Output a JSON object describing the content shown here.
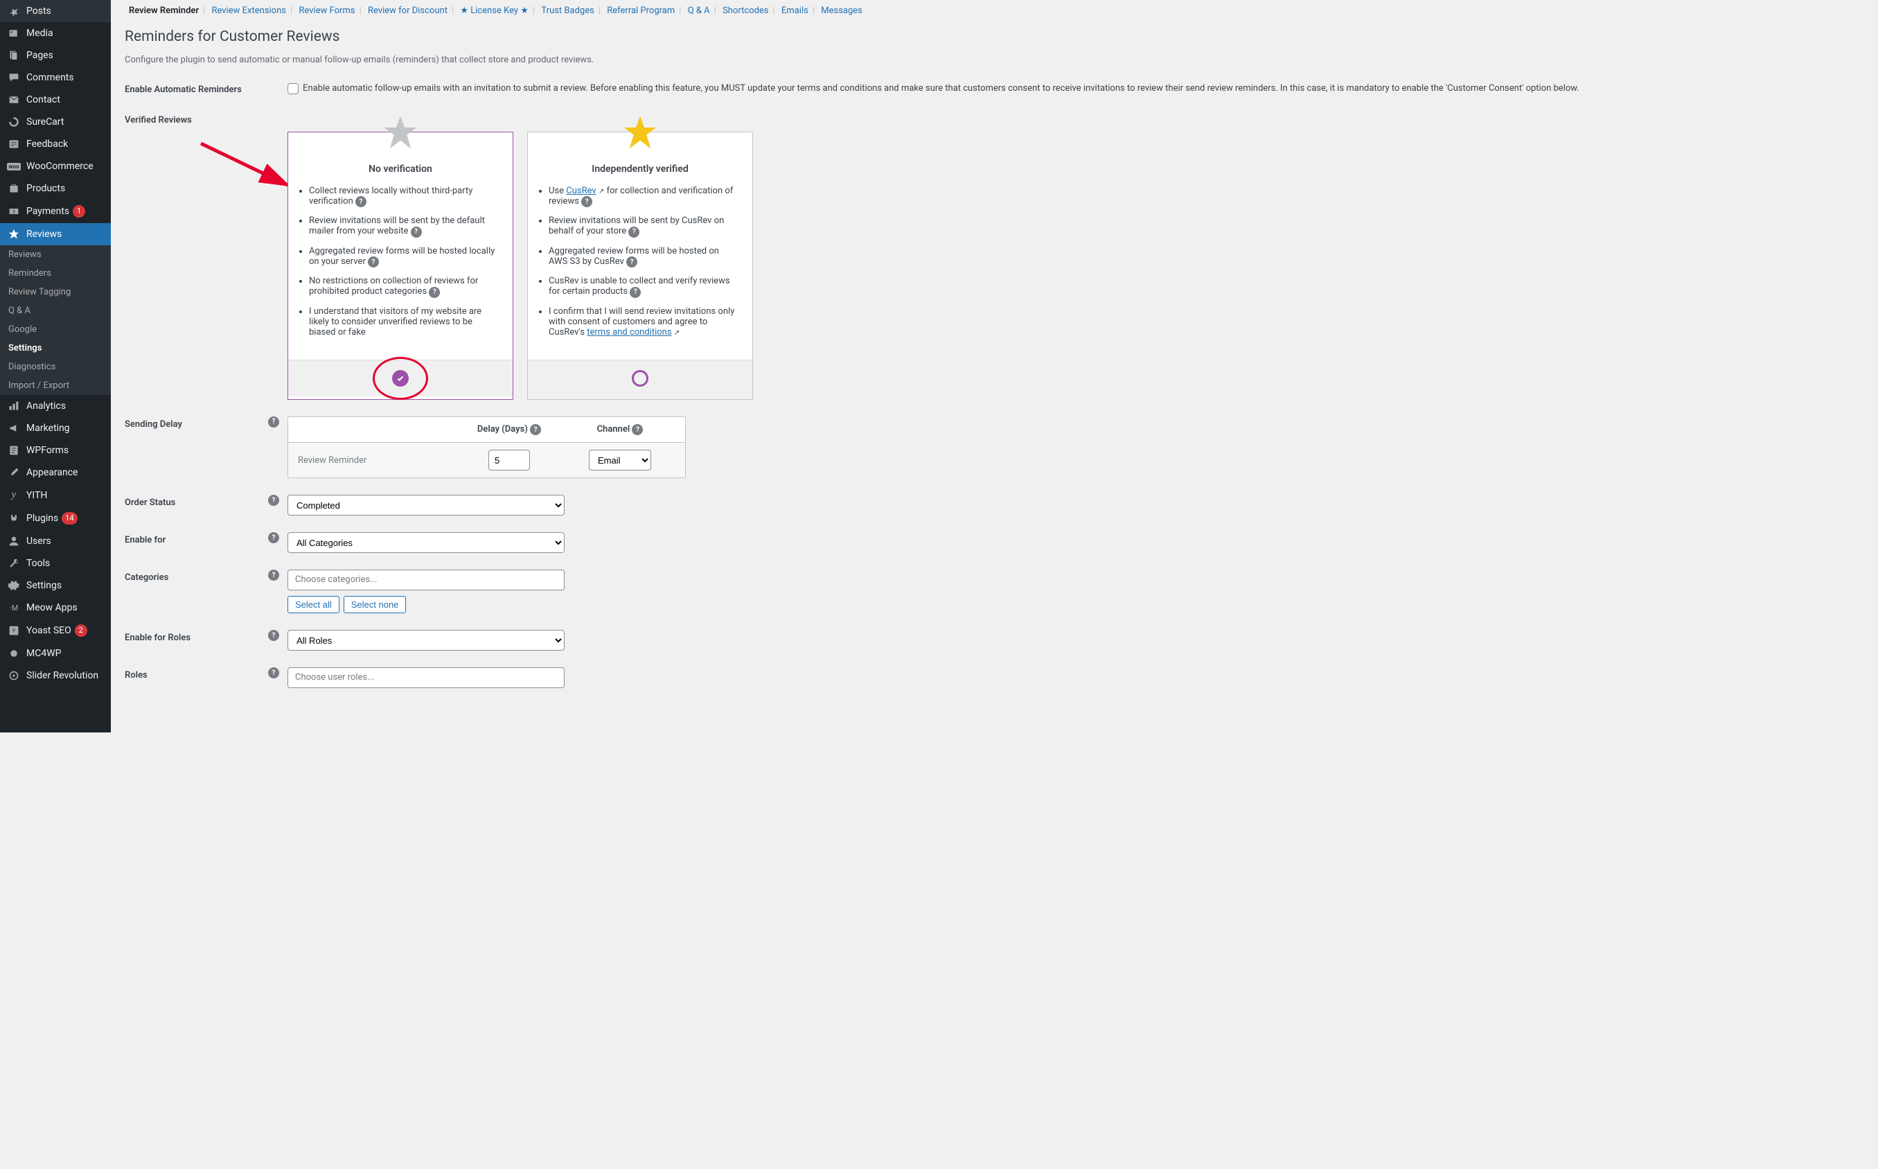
{
  "sidebar": {
    "items": [
      {
        "label": "Posts",
        "icon": "📌"
      },
      {
        "label": "Media",
        "icon": "🎞"
      },
      {
        "label": "Pages",
        "icon": "📄"
      },
      {
        "label": "Comments",
        "icon": "💬"
      },
      {
        "label": "Contact",
        "icon": "✉"
      },
      {
        "label": "SureCart",
        "icon": "◐"
      },
      {
        "label": "Feedback",
        "icon": "☰"
      },
      {
        "label": "WooCommerce",
        "icon": "WOO",
        "icon_class": "svg"
      },
      {
        "label": "Products",
        "icon": "📦"
      },
      {
        "label": "Payments",
        "icon": "$",
        "badge": "1"
      },
      {
        "label": "Reviews",
        "icon": "★",
        "active": true
      },
      {
        "label": "Analytics",
        "icon": "📊"
      },
      {
        "label": "Marketing",
        "icon": "📢"
      },
      {
        "label": "WPForms",
        "icon": "☰"
      },
      {
        "label": "Appearance",
        "icon": "🖌"
      },
      {
        "label": "YITH",
        "icon": "Y"
      },
      {
        "label": "Plugins",
        "icon": "🔌",
        "badge": "14"
      },
      {
        "label": "Users",
        "icon": "👤"
      },
      {
        "label": "Tools",
        "icon": "🔧"
      },
      {
        "label": "Settings",
        "icon": "⚙"
      },
      {
        "label": "Meow Apps",
        "icon": "·M"
      },
      {
        "label": "Yoast SEO",
        "icon": "Y",
        "badge": "2"
      },
      {
        "label": "MC4WP",
        "icon": "◉"
      },
      {
        "label": "Slider Revolution",
        "icon": "◎"
      }
    ],
    "submenu": [
      {
        "label": "Reviews"
      },
      {
        "label": "Reminders"
      },
      {
        "label": "Review Tagging"
      },
      {
        "label": "Q & A"
      },
      {
        "label": "Google"
      },
      {
        "label": "Settings",
        "current": true
      },
      {
        "label": "Diagnostics"
      },
      {
        "label": "Import / Export"
      }
    ]
  },
  "tabs": [
    {
      "label": "Review Reminder",
      "active": true
    },
    {
      "label": "Review Extensions"
    },
    {
      "label": "Review Forms"
    },
    {
      "label": "Review for Discount"
    },
    {
      "label": "★ License Key ★"
    },
    {
      "label": "Trust Badges"
    },
    {
      "label": "Referral Program"
    },
    {
      "label": "Q & A"
    },
    {
      "label": "Shortcodes"
    },
    {
      "label": "Emails"
    },
    {
      "label": "Messages"
    }
  ],
  "page": {
    "title": "Reminders for Customer Reviews",
    "description": "Configure the plugin to send automatic or manual follow-up emails (reminders) that collect store and product reviews."
  },
  "fields": {
    "enable_automatic_label": "Enable Automatic Reminders",
    "enable_automatic_desc": "Enable automatic follow-up emails with an invitation to submit a review. Before enabling this feature, you MUST update your terms and conditions and make sure that customers consent to receive invitations to review their send review reminders. In this case, it is mandatory to enable the 'Customer Consent' option below.",
    "verified_label": "Verified Reviews",
    "sending_delay_label": "Sending Delay",
    "order_status_label": "Order Status",
    "order_status_value": "Completed",
    "enable_for_label": "Enable for",
    "enable_for_value": "All Categories",
    "categories_label": "Categories",
    "categories_placeholder": "Choose categories...",
    "select_all": "Select all",
    "select_none": "Select none",
    "enable_for_roles_label": "Enable for Roles",
    "enable_for_roles_value": "All Roles",
    "roles_label": "Roles",
    "roles_placeholder": "Choose user roles..."
  },
  "delay": {
    "header_delay": "Delay (Days)",
    "header_channel": "Channel",
    "row_label": "Review Reminder",
    "row_value": "5",
    "row_channel": "Email"
  },
  "cards": {
    "left": {
      "title": "No verification",
      "items": [
        "Collect reviews locally without third-party verification",
        "Review invitations will be sent by the default mailer from your website",
        "Aggregated review forms will be hosted locally on your server",
        "No restrictions on collection of reviews for prohibited product categories",
        "I understand that visitors of my website are likely to consider unverified reviews to be biased or fake"
      ]
    },
    "right": {
      "title": "Independently verified",
      "cusrev_label": "CusRev",
      "terms_label": "terms and conditions",
      "item0_prefix": "Use ",
      "item0_suffix": " for collection and verification of reviews",
      "item1": "Review invitations will be sent by CusRev on behalf of your store",
      "item2": "Aggregated review forms will be hosted on AWS S3 by CusRev",
      "item3": "CusRev is unable to collect and verify reviews for certain products",
      "item4_prefix": "I confirm that I will send review invitations only with consent of customers and agree to CusRev's "
    }
  }
}
